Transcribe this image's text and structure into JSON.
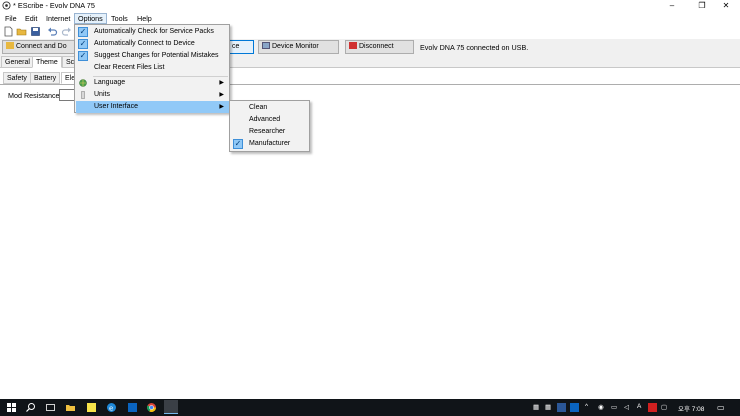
{
  "window": {
    "title": "* EScribe - Evolv DNA 75"
  },
  "menubar": {
    "items": [
      "File",
      "Edit",
      "Internet",
      "Options",
      "Tools",
      "Help"
    ]
  },
  "devicebar": {
    "connect_label": "Connect and Do",
    "device_label": "ce",
    "monitor_label": "Device Monitor",
    "disconnect_label": "Disconnect",
    "status": "Evolv DNA 75 connected on USB."
  },
  "tabs": {
    "top": [
      "General",
      "Theme",
      "Sc"
    ],
    "sub": [
      "Safety",
      "Battery",
      "Ele"
    ]
  },
  "content": {
    "mod_resistance_label": "Mod Resistance:"
  },
  "options_menu": {
    "check_service_packs": "Automatically Check for Service Packs",
    "connect_device": "Automatically Connect to Device",
    "suggest_changes": "Suggest Changes for Potential Mistakes",
    "clear_recent": "Clear Recent Files List",
    "language": "Language",
    "units": "Units",
    "user_interface": "User Interface"
  },
  "ui_submenu": {
    "clean": "Clean",
    "advanced": "Advanced",
    "researcher": "Researcher",
    "manufacturer": "Manufacturer"
  },
  "taskbar": {
    "clock": "오후 7:08",
    "ime": "A"
  },
  "colors": {
    "accent": "#0078d7",
    "menu_highlight": "#91c9f7",
    "check_bg": "#90c8f6",
    "taskbar": "#101418"
  }
}
